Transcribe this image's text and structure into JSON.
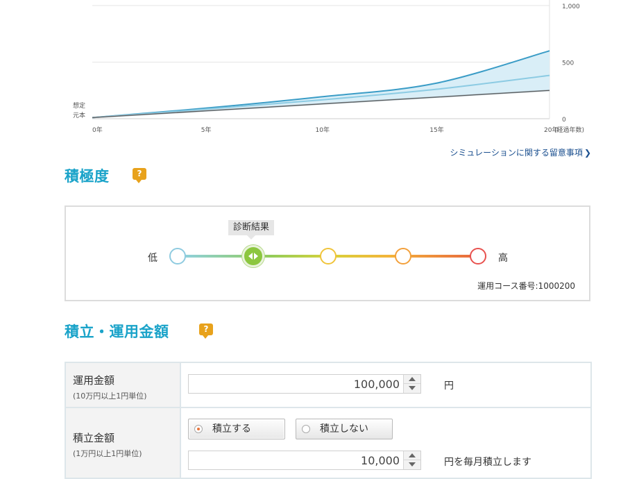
{
  "chart_data": {
    "type": "area",
    "x": [
      0,
      5,
      10,
      15,
      20
    ],
    "xticks": [
      "0年",
      "5年",
      "10年",
      "15年",
      "20年"
    ],
    "xlabel": "(経過年数)",
    "yticks": [
      "0",
      "500",
      "1,000"
    ],
    "ylim": [
      0,
      1000
    ],
    "y_axis_note": [
      "想定",
      "元本"
    ],
    "series": [
      {
        "role": "upper",
        "values": [
          10,
          94,
          193,
          312,
          600
        ]
      },
      {
        "role": "middle",
        "values": [
          10,
          85,
          166,
          259,
          383
        ]
      },
      {
        "role": "lower",
        "values": [
          10,
          70,
          130,
          190,
          250
        ]
      },
      {
        "role": "principal",
        "values": [
          10,
          70,
          130,
          190,
          250
        ]
      }
    ],
    "grid": true,
    "colors": {
      "upper": "#3a9cc6",
      "middle": "#8ccbe3",
      "band": "#d7eef7",
      "principal": "#555555"
    }
  },
  "notice_link": {
    "label": "シミュレーションに関する留意事項",
    "icon": "chevron-right-icon"
  },
  "risk": {
    "heading": "積極度",
    "low_label": "低",
    "high_label": "高",
    "result_tag": "診断結果",
    "selected_index": 1,
    "node_colors": [
      "#8fcbe0",
      "#8cc63f",
      "#f0c43a",
      "#f3a03a",
      "#e8514e"
    ],
    "course_number": "運用コース番号:1000200"
  },
  "amount": {
    "heading": "積立・運用金額",
    "invest": {
      "title": "運用金額",
      "sub": "(10万円以上1円単位)",
      "value": "100,000",
      "unit": "円"
    },
    "reserve": {
      "title": "積立金額",
      "sub": "(1万円以上1円単位)",
      "option_yes": "積立する",
      "option_no": "積立しない",
      "selected": "積立する",
      "value": "10,000",
      "unit": "円を毎月積立します"
    }
  }
}
